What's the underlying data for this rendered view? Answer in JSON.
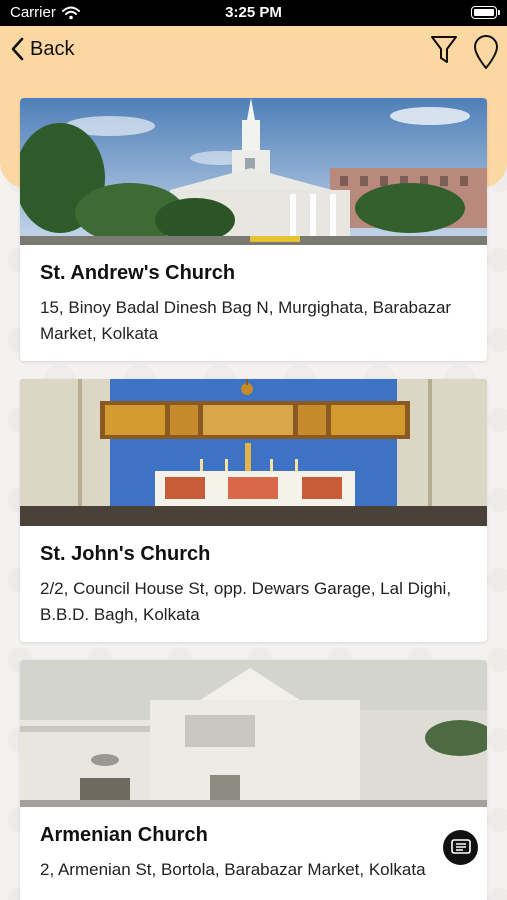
{
  "status_bar": {
    "carrier": "Carrier",
    "time": "3:25 PM"
  },
  "header": {
    "back_label": "Back",
    "accent_color": "#fbd7a2",
    "icons": [
      "back-chevron-icon",
      "filter-icon",
      "map-pin-icon"
    ]
  },
  "churches": [
    {
      "name": "St. Andrew's Church",
      "address": "15, Binoy Badal Dinesh Bag N, Murgighata, Barabazar Market, Kolkata"
    },
    {
      "name": "St. John's Church",
      "address": "2/2, Council House St, opp. Dewars Garage, Lal Dighi, B.B.D. Bagh, Kolkata"
    },
    {
      "name": "Armenian Church",
      "address": "2, Armenian St, Bortola, Barabazar Market, Kolkata"
    }
  ],
  "fab": {
    "icon": "chat-icon"
  }
}
